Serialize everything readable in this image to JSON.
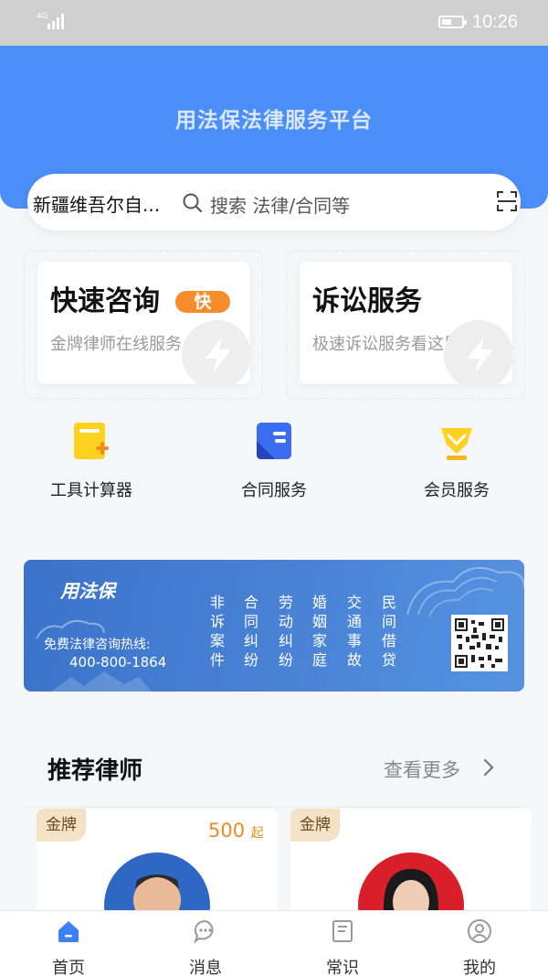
{
  "status_bar": {
    "network": "4G",
    "time": "10:26",
    "battery_level": 0.5
  },
  "header": {
    "title": "用法保法律服务平台"
  },
  "search": {
    "region": "新疆维吾尔自...",
    "placeholder": "搜索 法律/合同等"
  },
  "service_cards": [
    {
      "title": "快速咨询",
      "badge": "快",
      "subtitle": "金牌律师在线服务"
    },
    {
      "title": "诉讼服务",
      "badge": "",
      "subtitle": "极速诉讼服务看这里"
    }
  ],
  "quick_links": [
    {
      "label": "工具计算器",
      "icon": "calculator-icon"
    },
    {
      "label": "合同服务",
      "icon": "contract-icon"
    },
    {
      "label": "会员服务",
      "icon": "vip-icon"
    }
  ],
  "banner": {
    "brand": "用法保",
    "hotline_label": "免费法律咨询热线:",
    "phone": "400-800-1864",
    "columns": [
      [
        "非",
        "诉",
        "案",
        "件"
      ],
      [
        "合",
        "同",
        "纠",
        "纷"
      ],
      [
        "劳",
        "动",
        "纠",
        "纷"
      ],
      [
        "婚",
        "姻",
        "家",
        "庭"
      ],
      [
        "交",
        "通",
        "事",
        "故"
      ],
      [
        "民",
        "间",
        "借",
        "贷"
      ]
    ]
  },
  "recommended": {
    "title": "推荐律师",
    "see_more": "查看更多",
    "lawyers": [
      {
        "tag": "金牌",
        "price": "500",
        "price_suffix": "起"
      },
      {
        "tag": "金牌",
        "price": "",
        "price_suffix": ""
      }
    ]
  },
  "tabs": [
    {
      "label": "首页",
      "icon": "home-icon",
      "active": true
    },
    {
      "label": "消息",
      "icon": "message-icon",
      "active": false
    },
    {
      "label": "常识",
      "icon": "knowledge-icon",
      "active": false
    },
    {
      "label": "我的",
      "icon": "profile-icon",
      "active": false
    }
  ],
  "colors": {
    "primary": "#4b8ef8",
    "accent": "#f68d2a",
    "gold": "#f3e2c5",
    "active_tab": "#3d7ff5"
  }
}
